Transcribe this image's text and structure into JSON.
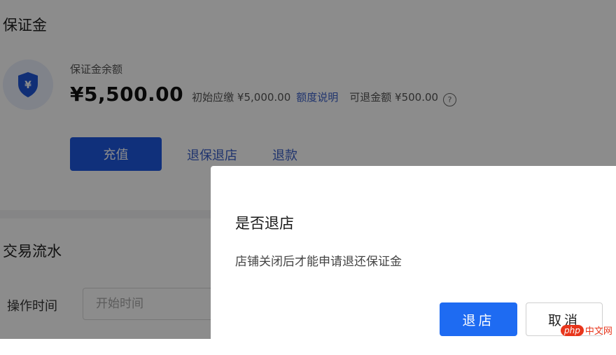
{
  "deposit": {
    "title": "保证金",
    "balance_label": "保证金余额",
    "balance_amount": "¥5,500.00",
    "initial_text": "初始应缴 ¥5,000.00",
    "quota_link": "额度说明",
    "refundable_text": "可退金额 ¥500.00",
    "help_icon_text": "?",
    "shield_symbol": "¥",
    "recharge_button": "充值",
    "close_store_link": "退保退店",
    "refund_link": "退款",
    "icon": "shield-yen-icon",
    "accent_color": "#1e58e0"
  },
  "transactions": {
    "title": "交易流水",
    "filter_label": "操作时间",
    "start_time_placeholder": "开始时间"
  },
  "dialog": {
    "title": "是否退店",
    "message": "店铺关闭后才能申请退还保证金",
    "confirm_button": "退店",
    "cancel_button": "取消"
  },
  "watermark": {
    "logo_text": "php",
    "site_text": "中文网"
  }
}
